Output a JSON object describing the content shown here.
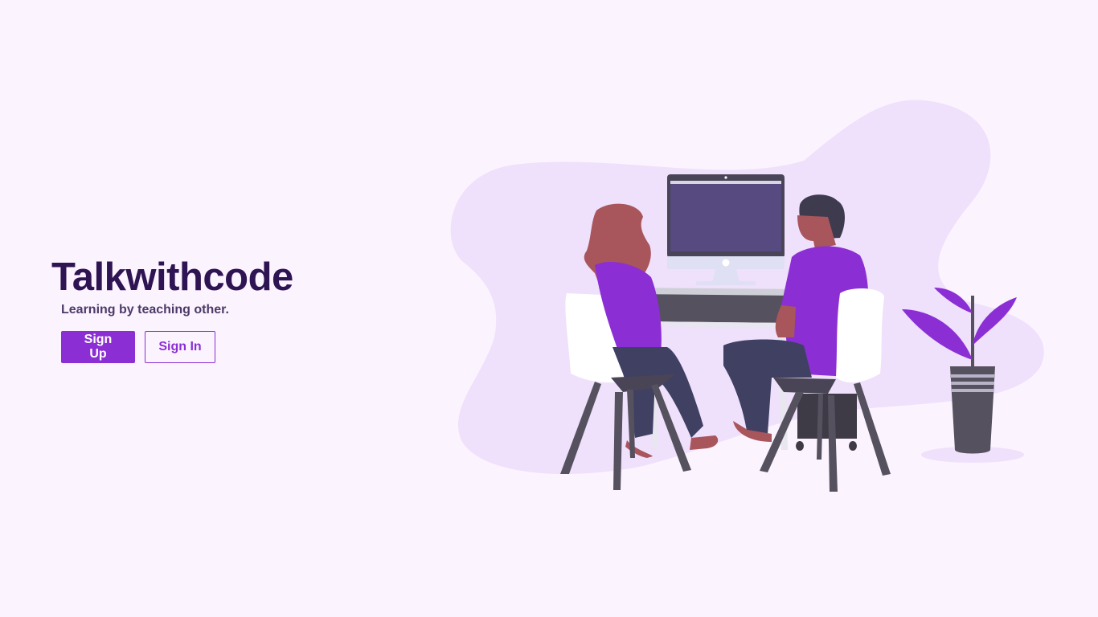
{
  "hero": {
    "title": "Talkwithcode",
    "tagline": "Learning by teaching other.",
    "signup_label": "Sign Up",
    "signin_label": "Sign In"
  },
  "colors": {
    "background": "#fbf3fe",
    "accent": "#8b2fd4",
    "title": "#2e1452",
    "blob": "#efe0fb"
  },
  "illustration": {
    "icon": "people-at-computer-illustration"
  }
}
